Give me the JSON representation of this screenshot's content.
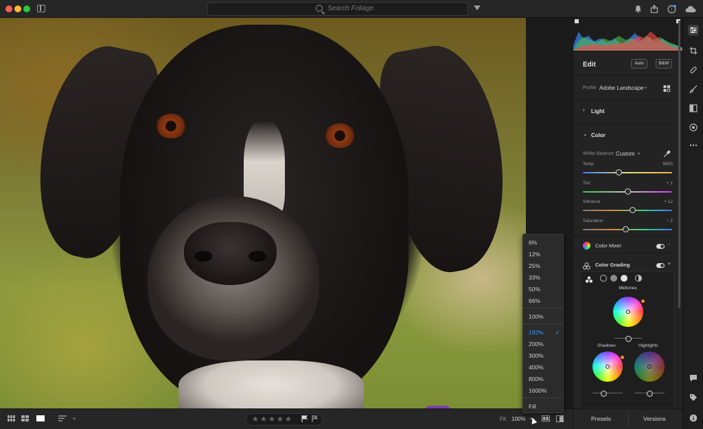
{
  "search": {
    "placeholder": "Search Foliage"
  },
  "edit_panel": {
    "title": "Edit",
    "auto_label": "Auto",
    "bw_label": "B&W",
    "profile_label": "Profile",
    "profile_value": "Adobe Landscape",
    "light_section": "Light",
    "color_section": "Color",
    "white_balance_label": "White Balance",
    "white_balance_value": "Custom",
    "sliders": [
      {
        "label": "Temp",
        "value": "5650",
        "position": 0.4
      },
      {
        "label": "Tint",
        "value": "+ 1",
        "position": 0.5
      },
      {
        "label": "Vibrance",
        "value": "+ 12",
        "position": 0.56
      },
      {
        "label": "Saturation",
        "value": "− 2",
        "position": 0.48
      }
    ],
    "color_mixer_label": "Color Mixer",
    "color_grading_label": "Color Grading",
    "midtones_label": "Midtones",
    "shadows_label": "Shadows",
    "highlights_label": "Highlights"
  },
  "zoom_menu": {
    "items": [
      "6%",
      "12%",
      "25%",
      "33%",
      "50%",
      "66%",
      "100%",
      "192%",
      "200%",
      "300%",
      "400%",
      "800%",
      "1600%",
      "Fill"
    ],
    "selected": "192%"
  },
  "bottom_bar": {
    "fit_label": "Fit",
    "zoom_value": "100%",
    "stars": [
      "★",
      "★",
      "★",
      "★",
      "★"
    ]
  },
  "bottom_panel": {
    "presets_label": "Presets",
    "versions_label": "Versions"
  },
  "icons": {
    "search": "search-icon",
    "filter": "filter-icon",
    "bell": "bell-icon",
    "share": "share-icon",
    "help": "help-icon",
    "cloud": "cloud-icon"
  },
  "colors": {
    "accent": "#3d9bff",
    "collar": "#7a3fb0"
  }
}
